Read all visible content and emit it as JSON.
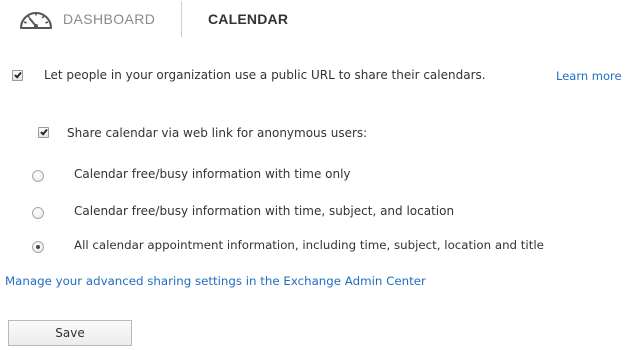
{
  "tabs": {
    "dashboard_label": "DASHBOARD",
    "calendar_label": "CALENDAR",
    "dashboard_icon": "dashboard-gauge-icon"
  },
  "public_url": {
    "checked": true,
    "label": "Let people in your organization use a public URL to share their calendars.",
    "learn_more": "Learn more"
  },
  "web_link": {
    "checked": true,
    "label": "Share calendar via web link for anonymous users:"
  },
  "sharing_options": [
    {
      "label": "Calendar free/busy information with time only",
      "selected": false
    },
    {
      "label": "Calendar free/busy information with time, subject, and location",
      "selected": false
    },
    {
      "label": "All calendar appointment information, including time, subject, location and title",
      "selected": true
    }
  ],
  "manage_link": "Manage your advanced sharing settings in the Exchange Admin Center",
  "save_label": "Save",
  "colors": {
    "link": "#1f6fc2",
    "text": "#333333",
    "muted_tab": "#8a8a8a"
  }
}
